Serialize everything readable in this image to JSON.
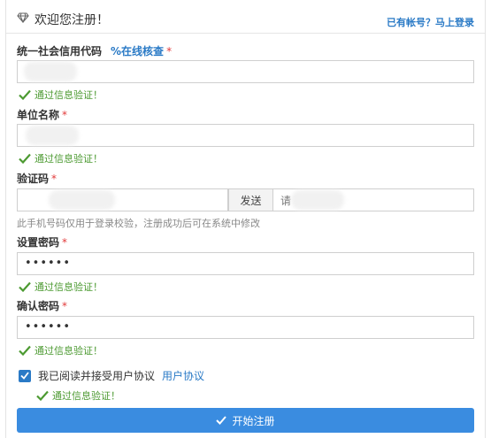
{
  "header": {
    "title": "欢迎您注册！",
    "login_link": "已有帐号？马上登录"
  },
  "fields": {
    "credit_code": {
      "label": "统一社会信用代码",
      "check_link": "在线核查",
      "required_mark": "*",
      "validation": "通过信息验证！"
    },
    "company_name": {
      "label": "单位名称",
      "required_mark": "*",
      "validation": "通过信息验证！"
    },
    "verification_code": {
      "label": "验证码",
      "required_mark": "*",
      "send_button": "发送",
      "second_input_partial": "请",
      "hint": "此手机号码仅用于登录校验，注册成功后可在系统中修改"
    },
    "password": {
      "label": "设置密码",
      "required_mark": "*",
      "value": "••••••",
      "validation": "通过信息验证！"
    },
    "confirm_password": {
      "label": "确认密码",
      "required_mark": "*",
      "value": "••••••",
      "validation": "通过信息验证！"
    }
  },
  "agreement": {
    "text": "我已阅读并接受用户协议",
    "link": "用户协议",
    "checked": true,
    "validation": "通过信息验证！"
  },
  "submit": {
    "label": "开始注册"
  },
  "colors": {
    "accent": "#2a7ac6",
    "success": "#4c9a31",
    "required": "#e23b3b",
    "button": "#3a8ce0"
  },
  "icons": {
    "title": "diamond-icon",
    "check_link": "link-icon",
    "validation": "checkmark-icon",
    "submit": "checkmark-icon"
  }
}
